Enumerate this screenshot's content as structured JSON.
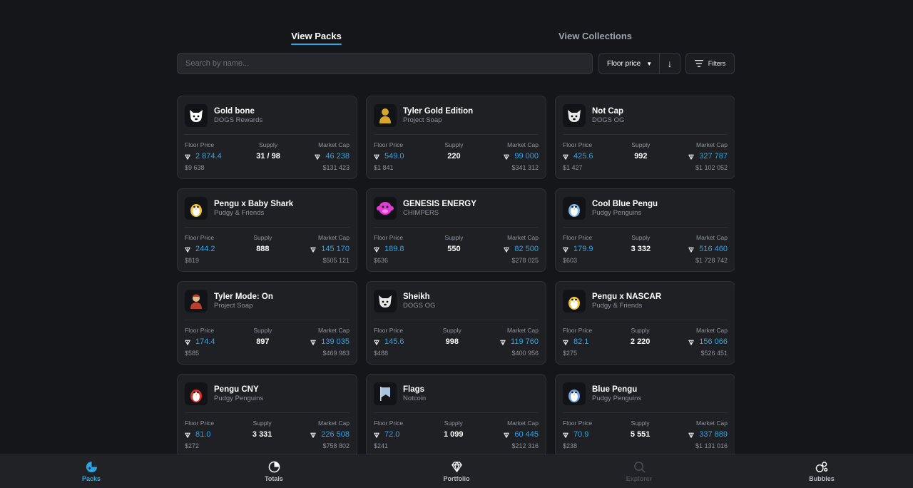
{
  "tabs": [
    {
      "label": "View Packs",
      "active": true
    },
    {
      "label": "View Collections",
      "active": false
    }
  ],
  "search": {
    "placeholder": "Search by name...",
    "value": ""
  },
  "sort": {
    "label": "Floor price",
    "direction_icon": "arrow-down-icon"
  },
  "filters": {
    "label": "Filters"
  },
  "stat_labels": {
    "floor": "Floor Price",
    "supply": "Supply",
    "mcap": "Market Cap"
  },
  "cards": [
    {
      "title": "Gold bone",
      "subtitle": "DOGS Rewards",
      "floor": "2 874.4",
      "floor_usd": "$9 638",
      "supply": "31 / 98",
      "mcap": "46 238",
      "mcap_usd": "$131 423",
      "icon": "dog-icon",
      "icon_color": "#ffffff"
    },
    {
      "title": "Tyler Gold Edition",
      "subtitle": "Project Soap",
      "floor": "549.0",
      "floor_usd": "$1 841",
      "supply": "220",
      "mcap": "99 000",
      "mcap_usd": "$341 312",
      "icon": "gold-figure-icon",
      "icon_color": "#d8a62a"
    },
    {
      "title": "Not Cap",
      "subtitle": "DOGS OG",
      "floor": "425.6",
      "floor_usd": "$1 427",
      "supply": "992",
      "mcap": "327 787",
      "mcap_usd": "$1 102 052",
      "icon": "dog-cap-icon",
      "icon_color": "#e8e8e8"
    },
    {
      "title": "Pengu x Baby Shark",
      "subtitle": "Pudgy & Friends",
      "floor": "244.2",
      "floor_usd": "$819",
      "supply": "888",
      "mcap": "145 170",
      "mcap_usd": "$505 121",
      "icon": "penguin-shark-icon",
      "icon_color": "#f2c23a"
    },
    {
      "title": "GENESIS ENERGY",
      "subtitle": "CHIMPERS",
      "floor": "189.8",
      "floor_usd": "$636",
      "supply": "550",
      "mcap": "82 500",
      "mcap_usd": "$278 025",
      "icon": "chimp-icon",
      "icon_color": "#e23bd6"
    },
    {
      "title": "Cool Blue Pengu",
      "subtitle": "Pudgy Penguins",
      "floor": "179.9",
      "floor_usd": "$603",
      "supply": "3 332",
      "mcap": "516 460",
      "mcap_usd": "$1 728 742",
      "icon": "penguin-icon",
      "icon_color": "#7fb6e8"
    },
    {
      "title": "Tyler Mode: On",
      "subtitle": "Project Soap",
      "floor": "174.4",
      "floor_usd": "$585",
      "supply": "897",
      "mcap": "139 035",
      "mcap_usd": "$469 983",
      "icon": "character-icon",
      "icon_color": "#b8402c"
    },
    {
      "title": "Sheikh",
      "subtitle": "DOGS OG",
      "floor": "145.6",
      "floor_usd": "$488",
      "supply": "998",
      "mcap": "119 760",
      "mcap_usd": "$400 956",
      "icon": "dog-sheikh-icon",
      "icon_color": "#e8e8e8"
    },
    {
      "title": "Pengu x NASCAR",
      "subtitle": "Pudgy & Friends",
      "floor": "82.1",
      "floor_usd": "$275",
      "supply": "2 220",
      "mcap": "156 066",
      "mcap_usd": "$526 451",
      "icon": "nascar-penguin-icon",
      "icon_color": "#f2c23a"
    },
    {
      "title": "Pengu CNY",
      "subtitle": "Pudgy Penguins",
      "floor": "81.0",
      "floor_usd": "$272",
      "supply": "3 331",
      "mcap": "226 508",
      "mcap_usd": "$758 802",
      "icon": "penguin-red-icon",
      "icon_color": "#d8302c"
    },
    {
      "title": "Flags",
      "subtitle": "Notcoin",
      "floor": "72.0",
      "floor_usd": "$241",
      "supply": "1 099",
      "mcap": "60 445",
      "mcap_usd": "$212 316",
      "icon": "flag-icon",
      "icon_color": "#a9c4e0"
    },
    {
      "title": "Blue Pengu",
      "subtitle": "Pudgy Penguins",
      "floor": "70.9",
      "floor_usd": "$238",
      "supply": "5 551",
      "mcap": "337 889",
      "mcap_usd": "$1 131 016",
      "icon": "penguin-icon",
      "icon_color": "#6fa6e0"
    }
  ],
  "nav": [
    {
      "label": "Packs",
      "icon": "packs-icon",
      "state": "active"
    },
    {
      "label": "Totals",
      "icon": "pie-chart-icon",
      "state": "normal"
    },
    {
      "label": "Portfolio",
      "icon": "diamond-icon",
      "state": "normal"
    },
    {
      "label": "Explorer",
      "icon": "search-icon",
      "state": "disabled"
    },
    {
      "label": "Bubbles",
      "icon": "bubbles-icon",
      "state": "normal"
    }
  ],
  "colors": {
    "accent": "#2aa6e8",
    "background": "#151619",
    "card": "#1f2024"
  }
}
